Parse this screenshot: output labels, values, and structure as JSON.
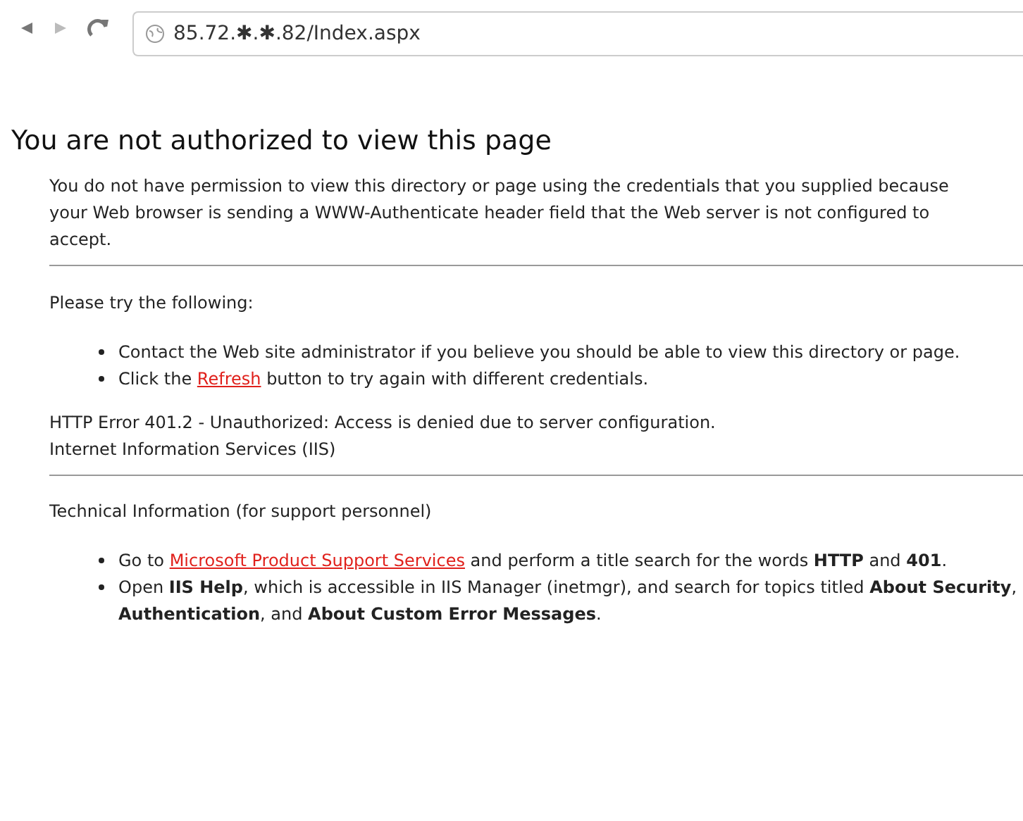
{
  "toolbar": {
    "address": "85.72.✱.✱.82/Index.aspx"
  },
  "heading": "You are not authorized to view this page",
  "intro": "You do not have permission to view this directory or page using the credentials that you supplied because your Web browser is sending a WWW-Authenticate header field that the Web server is not configured to accept.",
  "try_heading": "Please try the following:",
  "try_items": [
    [
      {
        "kind": "text",
        "text": "Contact the Web site administrator if you believe you should be able to view this directory or page."
      }
    ],
    [
      {
        "kind": "text",
        "text": "Click the "
      },
      {
        "kind": "link",
        "text": "Refresh"
      },
      {
        "kind": "text",
        "text": " button to try again with different credentials."
      }
    ]
  ],
  "error_lines": [
    "HTTP Error 401.2 - Unauthorized: Access is denied due to server configuration.",
    "Internet Information Services (IIS)"
  ],
  "tech_heading": "Technical Information (for support personnel)",
  "tech_items": [
    [
      {
        "kind": "text",
        "text": "Go to "
      },
      {
        "kind": "link",
        "text": "Microsoft Product Support Services"
      },
      {
        "kind": "text",
        "text": " and perform a title search for the words **HTTP** and **401**."
      }
    ],
    [
      {
        "kind": "text",
        "text": "Open **IIS Help**, which is accessible in IIS Manager (inetmgr), and search for topics titled **About Security**, **Authentication**, and **About Custom Error Messages**."
      }
    ]
  ]
}
